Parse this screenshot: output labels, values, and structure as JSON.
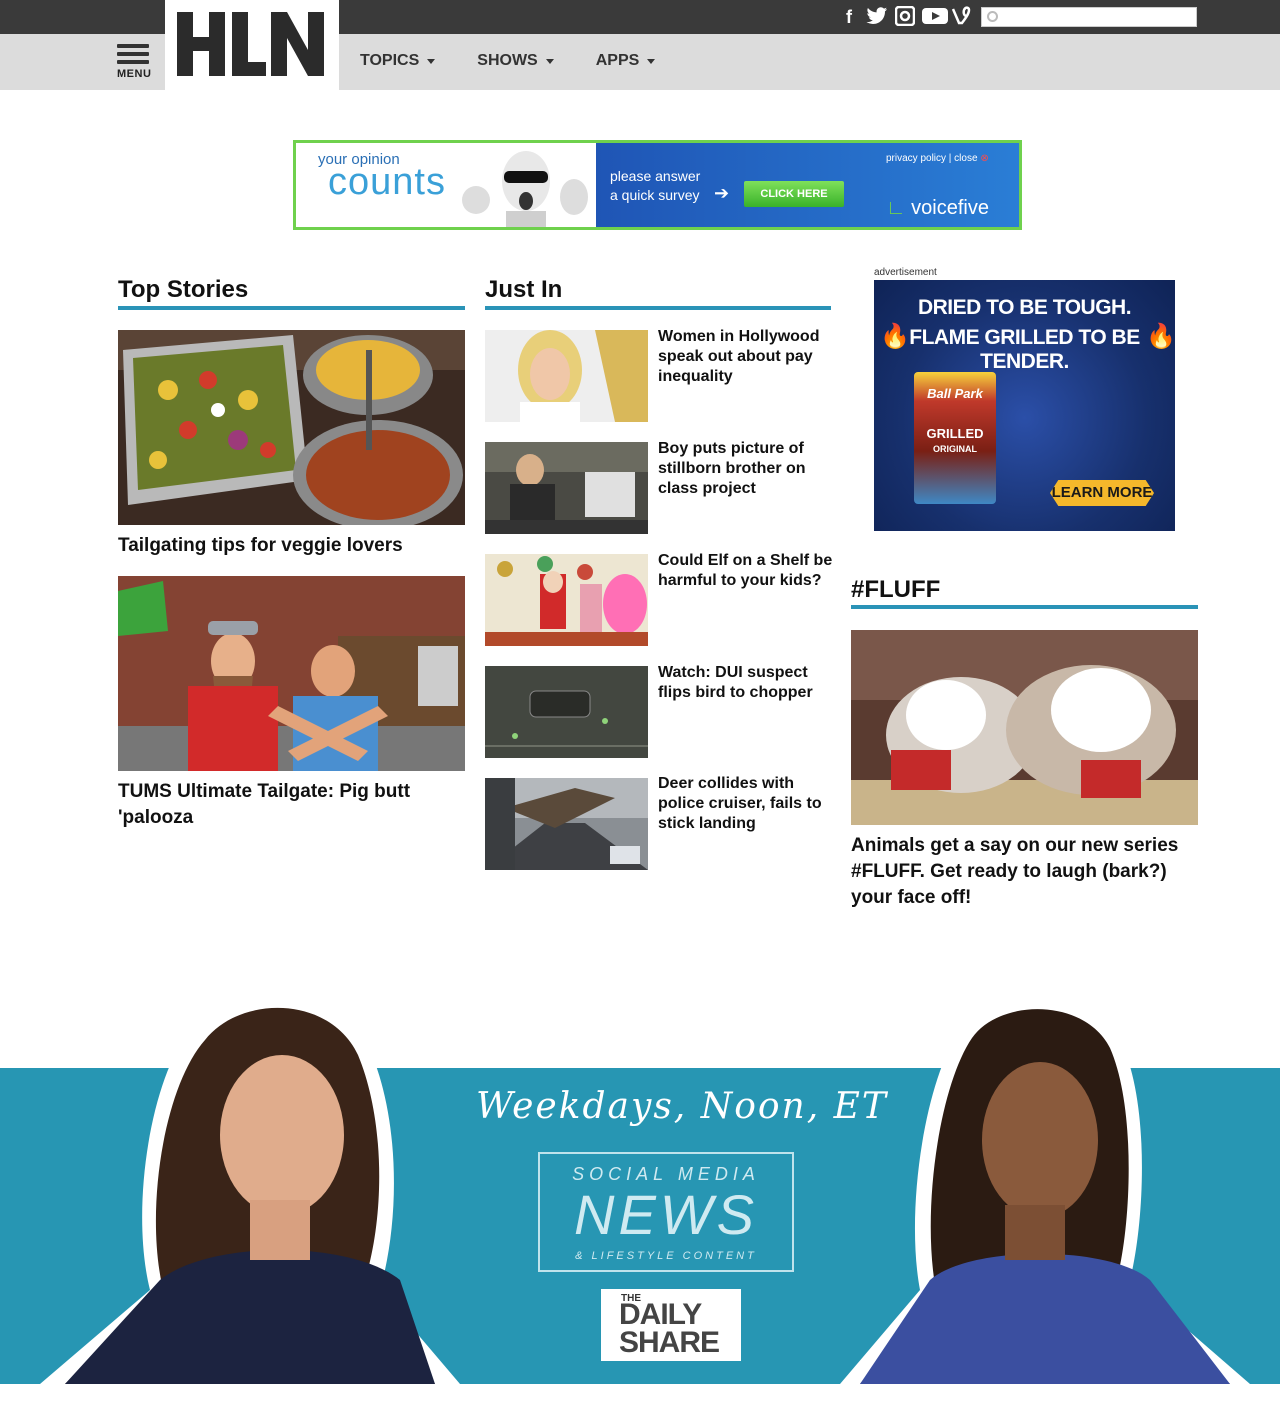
{
  "header": {
    "social": [
      "f",
      "twitter",
      "instagram",
      "youtube",
      "vine"
    ],
    "search_placeholder": "",
    "logo_text": "HLN",
    "menu_label": "MENU",
    "nav": [
      "TOPICS",
      "SHOWS",
      "APPS"
    ]
  },
  "survey_ad": {
    "your_opinion": "your opinion",
    "counts": "counts",
    "please_answer": "please answer",
    "quick_survey": "a quick survey",
    "click_here": "CLICK HERE",
    "privacy_close": "privacy policy | close",
    "brand": "voicefive"
  },
  "top_stories": {
    "heading": "Top Stories",
    "items": [
      {
        "title": "Tailgating tips for veggie lovers"
      },
      {
        "title": "TUMS Ultimate Tailgate: Pig butt 'palooza"
      }
    ]
  },
  "just_in": {
    "heading": "Just In",
    "items": [
      {
        "title": "Women in Hollywood speak out about pay inequality"
      },
      {
        "title": "Boy puts picture of stillborn brother on class project"
      },
      {
        "title": "Could Elf on a Shelf be harmful to your kids?"
      },
      {
        "title": "Watch: DUI suspect flips bird to chopper"
      },
      {
        "title": "Deer collides with police cruiser, fails to stick landing"
      }
    ]
  },
  "ad": {
    "label": "advertisement",
    "line1": "DRIED TO BE TOUGH.",
    "line2": "FLAME GRILLED TO BE TENDER.",
    "brand": "Ball Park",
    "product": "GRILLED",
    "flavor": "ORIGINAL",
    "cta": "LEARN MORE"
  },
  "fluff": {
    "heading": "#FLUFF",
    "caption": "Animals get a say on our new series #FLUFF. Get ready to laugh (bark?) your face off!"
  },
  "promo": {
    "schedule": "Weekdays, Noon, ET",
    "social_media": "SOCIAL MEDIA",
    "news": "NEWS",
    "lifestyle": "& LIFESTYLE CONTENT",
    "the": "THE",
    "daily_share": "DAILY SHARE"
  }
}
